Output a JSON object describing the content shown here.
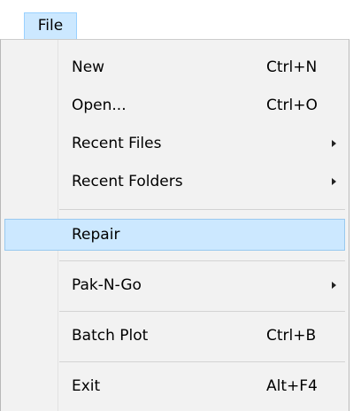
{
  "menubar": {
    "title": "File"
  },
  "menu": {
    "new": {
      "label": "New",
      "shortcut": "Ctrl+N"
    },
    "open": {
      "label": "Open...",
      "shortcut": "Ctrl+O"
    },
    "recent_files": {
      "label": "Recent Files"
    },
    "recent_folders": {
      "label": "Recent Folders"
    },
    "repair": {
      "label": "Repair"
    },
    "pak_n_go": {
      "label": "Pak-N-Go"
    },
    "batch_plot": {
      "label": "Batch Plot",
      "shortcut": "Ctrl+B"
    },
    "exit": {
      "label": "Exit",
      "shortcut": "Alt+F4"
    }
  },
  "colors": {
    "highlight": "#cce8ff",
    "highlight_border": "#99c9ef",
    "menu_background": "#f2f2f2"
  }
}
